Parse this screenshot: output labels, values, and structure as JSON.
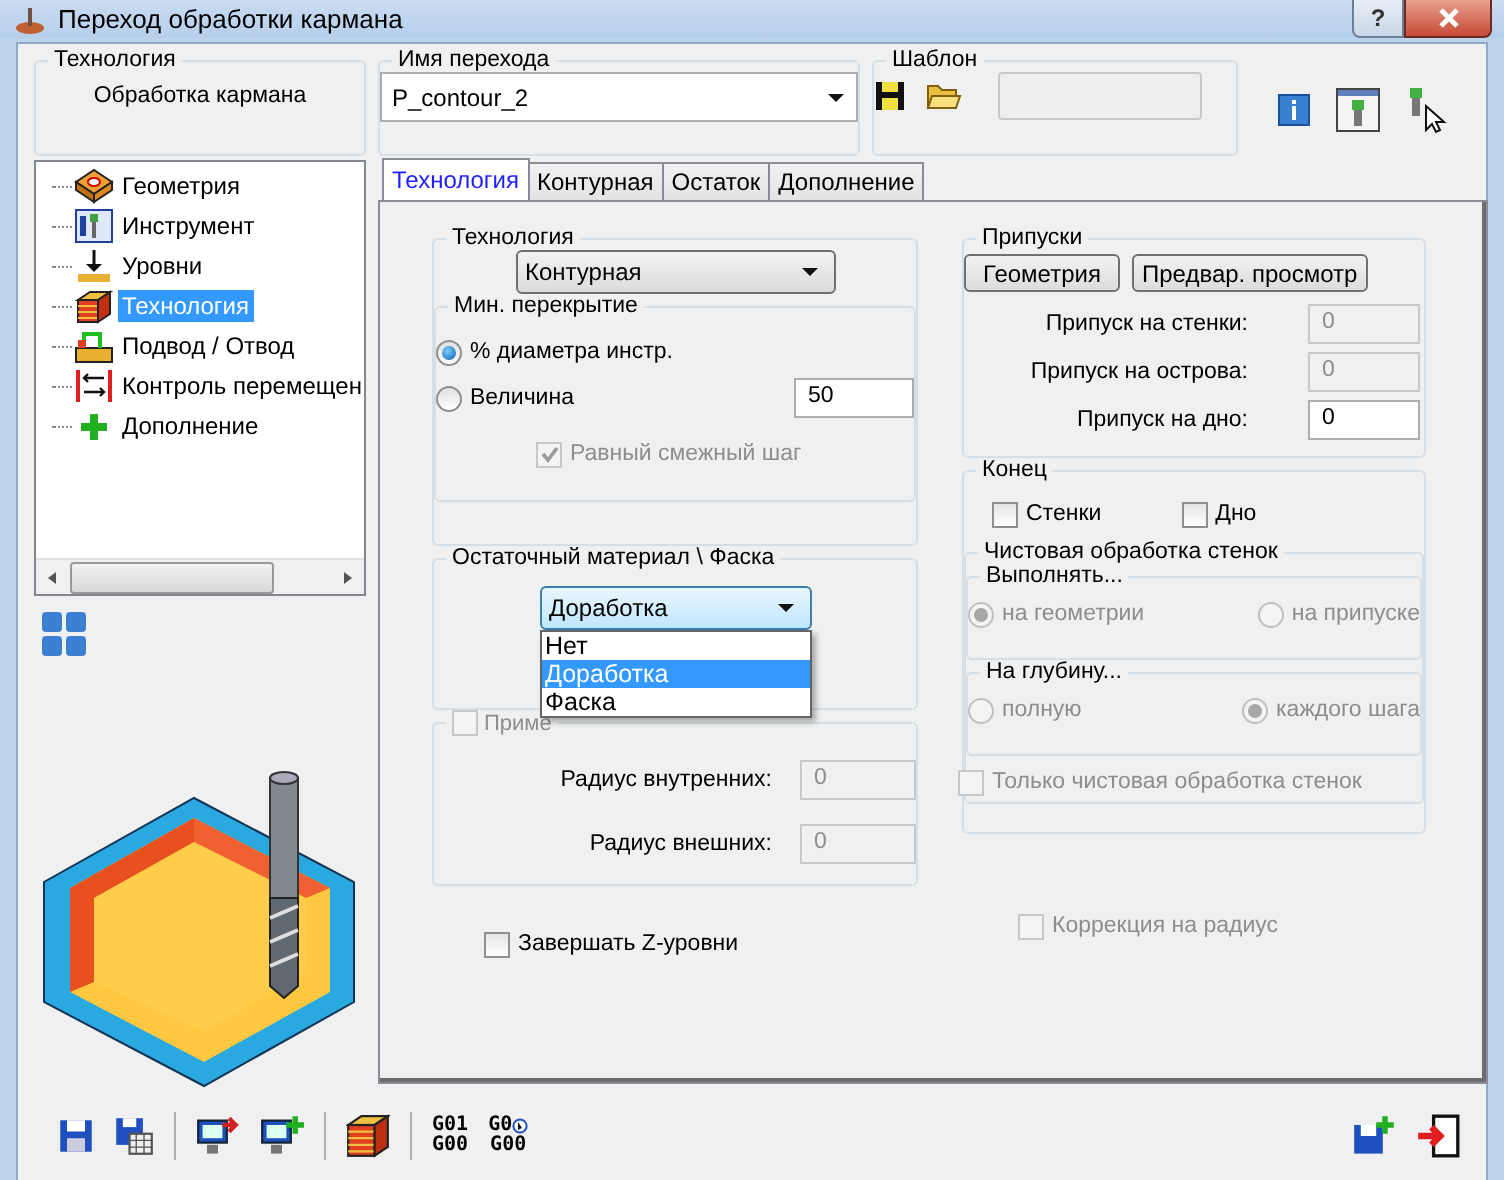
{
  "window": {
    "title": "Переход обработки кармана",
    "help": "?"
  },
  "technology": {
    "label": "Технология",
    "value": "Обработка кармана"
  },
  "operation_name": {
    "label": "Имя перехода",
    "value": "P_contour_2"
  },
  "template": {
    "label": "Шаблон"
  },
  "tree": {
    "items": [
      {
        "label": "Геометрия",
        "selected": false
      },
      {
        "label": "Инструмент",
        "selected": false
      },
      {
        "label": "Уровни",
        "selected": false
      },
      {
        "label": "Технология",
        "selected": true
      },
      {
        "label": "Подвод / Отвод",
        "selected": false
      },
      {
        "label": "Контроль перемещен",
        "selected": false
      },
      {
        "label": "Дополнение",
        "selected": false
      }
    ]
  },
  "tabs": [
    {
      "label": "Технология",
      "selected": true
    },
    {
      "label": "Контурная",
      "selected": false
    },
    {
      "label": "Остаток",
      "selected": false
    },
    {
      "label": "Дополнение",
      "selected": false
    }
  ],
  "technology_group": {
    "label": "Технология",
    "dropdown": "Контурная",
    "overlap": {
      "label": "Мин. перекрытие",
      "options": [
        {
          "label": "% диаметра инстр.",
          "selected": true
        },
        {
          "label": "Величина",
          "selected": false
        }
      ],
      "value": "50",
      "equal_step": {
        "label": "Равный смежный шаг",
        "checked": true,
        "disabled": true
      }
    }
  },
  "remainder_group": {
    "label": "Остаточный материал \\ Фаска",
    "dropdown": {
      "value": "Доработка",
      "expanded": true,
      "options": [
        {
          "label": "Нет",
          "selected": false
        },
        {
          "label": "Доработка",
          "selected": true
        },
        {
          "label": "Фаска",
          "selected": false
        }
      ]
    }
  },
  "apply_group": {
    "checkbox": {
      "label": "Приме",
      "checked": false,
      "disabled": true
    },
    "fields": [
      {
        "label": "Радиус внутренних:",
        "value": "0",
        "disabled": true
      },
      {
        "label": "Радиус внешних:",
        "value": "0",
        "disabled": true
      }
    ]
  },
  "finish_z": {
    "label": "Завершать Z-уровни",
    "checked": false,
    "disabled": false
  },
  "allowances": {
    "label": "Припуски",
    "buttons": [
      "Геометрия",
      "Предвар. просмотр"
    ],
    "fields": [
      {
        "label": "Припуск на стенки:",
        "value": "0",
        "disabled": true
      },
      {
        "label": "Припуск на острова:",
        "value": "0",
        "disabled": true
      },
      {
        "label": "Припуск на дно:",
        "value": "0",
        "disabled": false
      }
    ]
  },
  "end": {
    "label": "Конец",
    "checks": [
      {
        "label": "Стенки",
        "checked": false
      },
      {
        "label": "Дно",
        "checked": false
      }
    ],
    "wall_finish": {
      "label": "Чистовая обработка стенок",
      "disabled": true,
      "perform": {
        "label": "Выполнять...",
        "options": [
          {
            "label": "на геометрии",
            "selected": true
          },
          {
            "label": "на припуске",
            "selected": false
          }
        ]
      },
      "depth": {
        "label": "На глубину...",
        "options": [
          {
            "label": "полную",
            "selected": false
          },
          {
            "label": "каждого шага",
            "selected": true
          }
        ]
      },
      "only": {
        "label": "Только чистовая обработка стенок",
        "checked": false
      }
    }
  },
  "radius_correction": {
    "label": "Коррекция на радиус",
    "checked": false,
    "disabled": true
  },
  "gcode_buttons": [
    {
      "lines": [
        "G01",
        "G00"
      ]
    },
    {
      "lines": [
        "G0",
        "G00"
      ]
    }
  ]
}
